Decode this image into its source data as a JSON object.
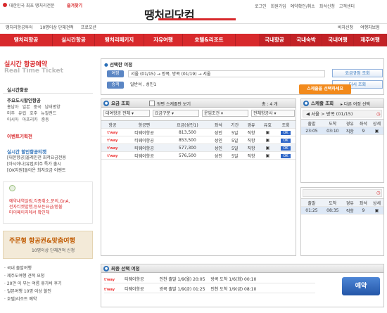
{
  "header": {
    "tagline": "대한민국 최초 땡처리전문",
    "bookmark": "즐겨찾기",
    "logo": "땡처리닷컴",
    "top_links": [
      "로그인",
      "회원가입",
      "예약확인/취소",
      "좌석신청",
      "고객센터"
    ],
    "sub_links_left": [
      "땡처리항공투어",
      "10명이상 단체견적",
      "프로모션"
    ],
    "sub_links_right": [
      "비자신청",
      "여행자보험"
    ]
  },
  "nav": {
    "left": [
      "땡처리항공",
      "실시간항공",
      "땡처리패키지",
      "자유여행",
      "호텔&리조트"
    ],
    "right": [
      "국내항공",
      "국내숙박",
      "국내여행",
      "제주여행"
    ]
  },
  "sidebar": {
    "title": "실시간 항공예약",
    "subtitle": "Real Time Ticket",
    "menu_title": "실시간항공",
    "discount_title": "주요도시할인항공",
    "cities": [
      [
        "홍남아",
        "일본",
        "중국",
        "남태평양"
      ],
      [
        "미주",
        "유럽",
        "호주",
        "뉴질랜드"
      ],
      [
        "아시아",
        "아프리카",
        "중동"
      ]
    ],
    "event": "이벤트기획전",
    "realtime_title": "실시간 할인항공티켓",
    "tickets": [
      "[대한항공]올레인천 최저요금전용",
      "[아시아나]유럽/미주 특가 출시",
      "[OK지원]돌아온 최저요금 이벤트"
    ],
    "notice": [
      "예약내역알림,각종취소,문의,GnA,",
      "전자티켓발행,등모든요금/환불",
      "마이페이지에서 확인해"
    ],
    "ad_title": "주문형 항공권&맞춤여행",
    "ad_sub": "10명이상 단체견적 신청",
    "links": [
      "국내 출발여행",
      "제주도여행 견적 요청",
      "20만 이 부는 여름 휴가비 후기",
      "일본여행 10명 이상 할인",
      "호텔/리조트 예약"
    ]
  },
  "search": {
    "header": "선택한 여정",
    "route_label": "여정",
    "route_value": "서울 (01/15) → 방콕, 방콕 (01/19) → 서울",
    "passenger_label": "승객",
    "passenger_value": "일반석 , 성인1",
    "btn_fare": "요금규정 조회",
    "btn_reset": "다시 조회"
  },
  "fare": {
    "header": "요금 조회",
    "checkbox_label": "왕편 스케줄만 보기",
    "count": "총 : 4 개",
    "filters": [
      "대여항공 전체",
      "요금구분",
      "운임조건",
      "전체항공사"
    ],
    "columns": [
      "항공",
      "항공편",
      "요금(성인1)",
      "좌석",
      "기간",
      "경유",
      "유효",
      "조회"
    ],
    "rows": [
      {
        "airline": "티웨이항공",
        "price": "813,500",
        "seat": "성인",
        "period": "5일",
        "stop": "직항"
      },
      {
        "airline": "티웨이항공",
        "price": "853,500",
        "seat": "성인",
        "period": "5일",
        "stop": "직항"
      },
      {
        "airline": "티웨이항공",
        "price": "577,300",
        "seat": "성인",
        "period": "5일",
        "stop": "직항"
      },
      {
        "airline": "티웨이항공",
        "price": "576,500",
        "seat": "성인",
        "period": "5일",
        "stop": "직항"
      }
    ]
  },
  "tooltip": "스케줄을 선택하세요",
  "schedule": {
    "header": "스케줄 조회",
    "next_label": "다른 여정 선택",
    "route1": "서울 > 방콕",
    "date1": "(01/15)",
    "columns": [
      "출발",
      "도착",
      "경유",
      "좌석",
      "상세"
    ],
    "rows1": [
      [
        "23:05",
        "03:10",
        "직항",
        "9"
      ]
    ],
    "rows2": [
      [
        "01:25",
        "08:35",
        "직항",
        "9"
      ]
    ]
  },
  "final": {
    "header": "최종 선택 여정",
    "rows": [
      {
        "airline": "티웨이항공",
        "depart": "인천 출발 1/9(월) 20:05",
        "arrive": "방콕 도착 1/6(화) 00:10"
      },
      {
        "airline": "티웨이항공",
        "depart": "방콕 출발 1/9(금) 01:25",
        "arrive": "인천 도착 1/9(금) 08:10"
      }
    ],
    "book_btn": "예약"
  },
  "colors": {
    "brand_red": "#d8292c",
    "blue": "#2a6fb8",
    "orange": "#f28a1c"
  }
}
